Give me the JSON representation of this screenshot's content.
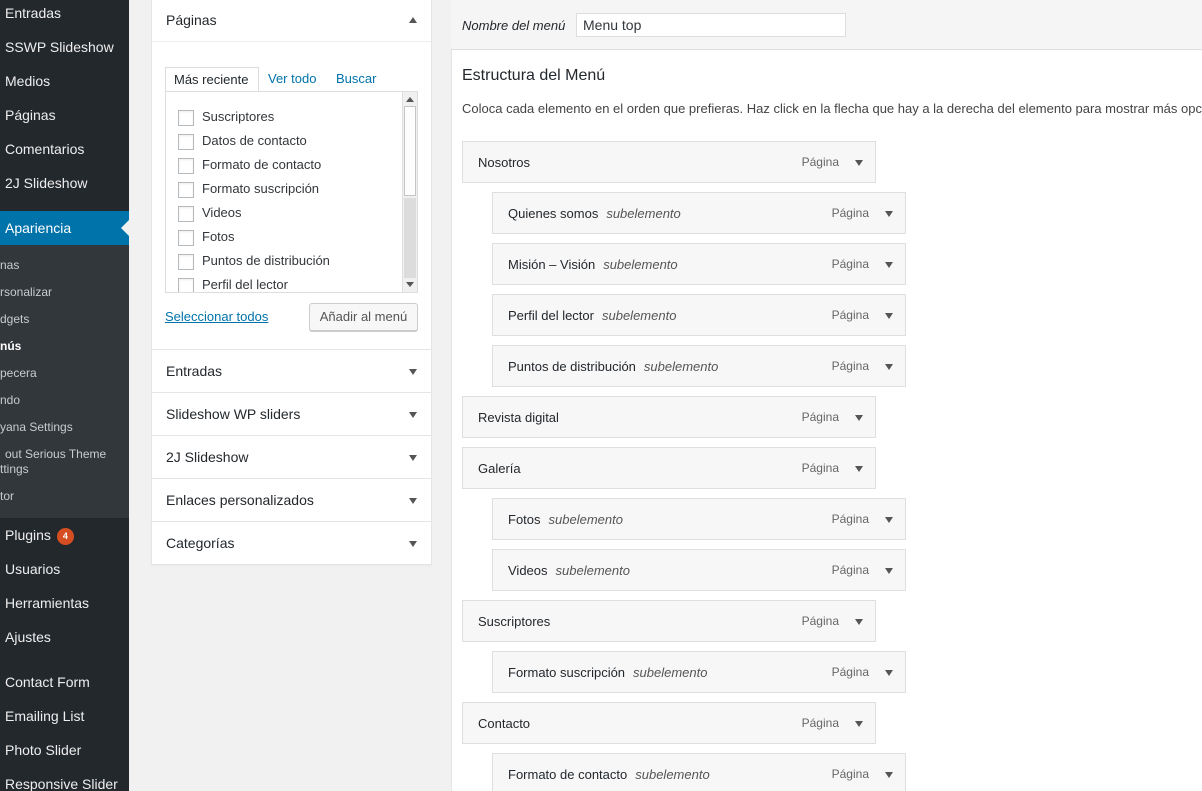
{
  "sidebar": {
    "items_top": [
      "Entradas",
      "SSWP Slideshow",
      "Medios",
      "Páginas",
      "Comentarios",
      "2J Slideshow"
    ],
    "active": "Apariencia",
    "submenu": [
      "nas",
      "rsonalizar",
      "dgets",
      "nús",
      "pecera",
      "ndo",
      "yana Settings",
      "out Serious Theme",
      "ttings",
      "tor"
    ],
    "items_bottom": [
      "Plugins",
      "Usuarios",
      "Herramientas",
      "Ajustes",
      "Contact Form",
      "Emailing List",
      "Photo Slider",
      "Responsive Slider"
    ],
    "plugins_badge": "4"
  },
  "pages_panel": {
    "title": "Páginas",
    "tabs": [
      "Más reciente",
      "Ver todo",
      "Buscar"
    ],
    "items": [
      "Suscriptores",
      "Datos de contacto",
      "Formato de contacto",
      "Formato suscripción",
      "Videos",
      "Fotos",
      "Puntos de distribución",
      "Perfil del lector"
    ],
    "select_all": "Seleccionar todos",
    "add_button": "Añadir al menú"
  },
  "accordion": [
    "Entradas",
    "Slideshow WP sliders",
    "2J Slideshow",
    "Enlaces personalizados",
    "Categorías"
  ],
  "menu": {
    "name_label": "Nombre del menú",
    "name_value": "Menu top",
    "structure_title": "Estructura del Menú",
    "structure_desc": "Coloca cada elemento en el orden que prefieras. Haz click en la flecha que hay a la derecha del elemento para mostrar más opc",
    "sub_label": "subelemento",
    "type_label": "Página",
    "items": [
      {
        "title": "Nosotros",
        "level": 0
      },
      {
        "title": "Quienes somos",
        "level": 1
      },
      {
        "title": "Misión – Visión",
        "level": 1
      },
      {
        "title": "Perfil del lector",
        "level": 1
      },
      {
        "title": "Puntos de distribución",
        "level": 1
      },
      {
        "title": "Revista digital",
        "level": 0
      },
      {
        "title": "Galería",
        "level": 0
      },
      {
        "title": "Fotos",
        "level": 1
      },
      {
        "title": "Videos",
        "level": 1
      },
      {
        "title": "Suscriptores",
        "level": 0
      },
      {
        "title": "Formato suscripción",
        "level": 1
      },
      {
        "title": "Contacto",
        "level": 0
      },
      {
        "title": "Formato de contacto",
        "level": 1
      }
    ]
  }
}
